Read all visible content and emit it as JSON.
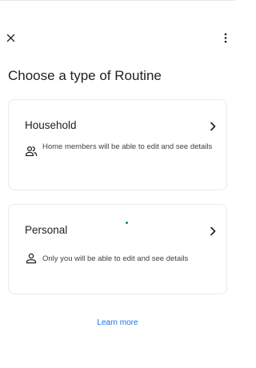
{
  "header": {
    "close_icon": "close-icon",
    "more_icon": "more-vert-icon"
  },
  "page": {
    "title": "Choose a type of Routine"
  },
  "cards": {
    "household": {
      "title": "Household",
      "description": "Home members will be able to edit and see details",
      "icon": "people-icon"
    },
    "personal": {
      "title": "Personal",
      "description": "Only you will be able to edit and see details",
      "icon": "person-icon"
    }
  },
  "footer": {
    "learn_more": "Learn more"
  },
  "colors": {
    "text": "#202124",
    "secondary_text": "#3c4043",
    "link": "#1a73e8",
    "card_border": "#e8eaed",
    "indicator": "#1e8e3e"
  }
}
